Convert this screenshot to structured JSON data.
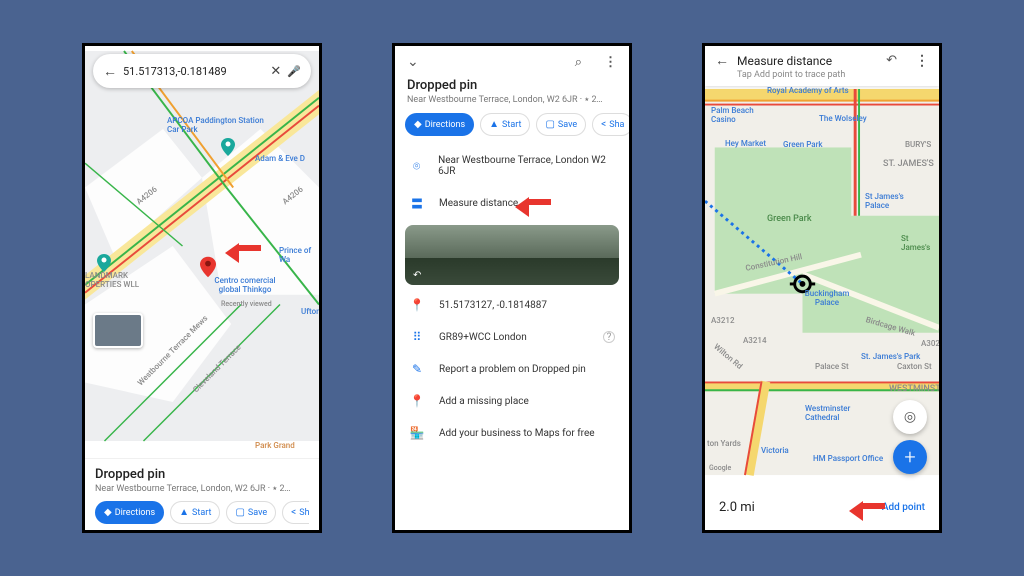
{
  "phone1": {
    "search_value": "51.517313,-0.181489",
    "bottom": {
      "title": "Dropped pin",
      "subtitle": "Near Westbourne Terrace, London, W2 6JR · ⭑ 2…",
      "directions": "Directions",
      "start": "Start",
      "save": "Save",
      "share": "Sha"
    },
    "labels": {
      "parking": "APCOA Paddington Station Car Park",
      "adam": "Adam & Eve D",
      "road": "A4206",
      "landmark": "LANDMARK OPERTIES WLL",
      "prince": "Prince of Wa",
      "centro": "Centro comercial global Thinkgo",
      "recent": "Recently viewed",
      "ufton": "Ufton",
      "wterrace": "Westbourne Terrace Mews",
      "cterrace": "Cleveland Terrace",
      "parkgrand": "Park Grand"
    }
  },
  "phone2": {
    "title": "Dropped pin",
    "subtitle": "Near Westbourne Terrace, London, W2 6JR · ⭑ 2…",
    "directions": "Directions",
    "start": "Start",
    "save": "Save",
    "share": "Sha",
    "address": "Near Westbourne Terrace, London W2 6JR",
    "measure": "Measure distance",
    "coords": "51.5173127, -0.1814887",
    "pluscode": "GR89+WCC London",
    "report": "Report a problem on Dropped pin",
    "missing": "Add a missing place",
    "business": "Add your business to Maps for free"
  },
  "phone3": {
    "title": "Measure distance",
    "subtitle": "Tap Add point to trace path",
    "distance": "2.0 mi",
    "addpoint": "Add point",
    "labels": {
      "royal": "Royal Academy of Arts",
      "palmbeach": "Palm Beach Casino",
      "wolseley": "The Wolseley",
      "heymarket": "Hey Market",
      "greenpark": "Green Park",
      "burys": "BURY'S",
      "stjames": "ST. JAMES'S",
      "palace": "St James's Palace",
      "greenparkbig": "Green Park",
      "stjamess": "St James's",
      "constitution": "Constitution Hill",
      "buckingham": "Buckingham Palace",
      "birdcage": "Birdcage Walk",
      "a3": "A3212",
      "a3b": "A3214",
      "road302": "A302",
      "wilton": "Wilton Rd",
      "stjamespark": "St. James's Park",
      "palacest": "Palace St",
      "caxton": "Caxton St",
      "westminster": "WESTMINSTE",
      "cathedral": "Westminster Cathedral",
      "yards": "ton Yards",
      "victoria": "Victoria",
      "passport": "HM Passport Office",
      "google": "Google"
    }
  }
}
